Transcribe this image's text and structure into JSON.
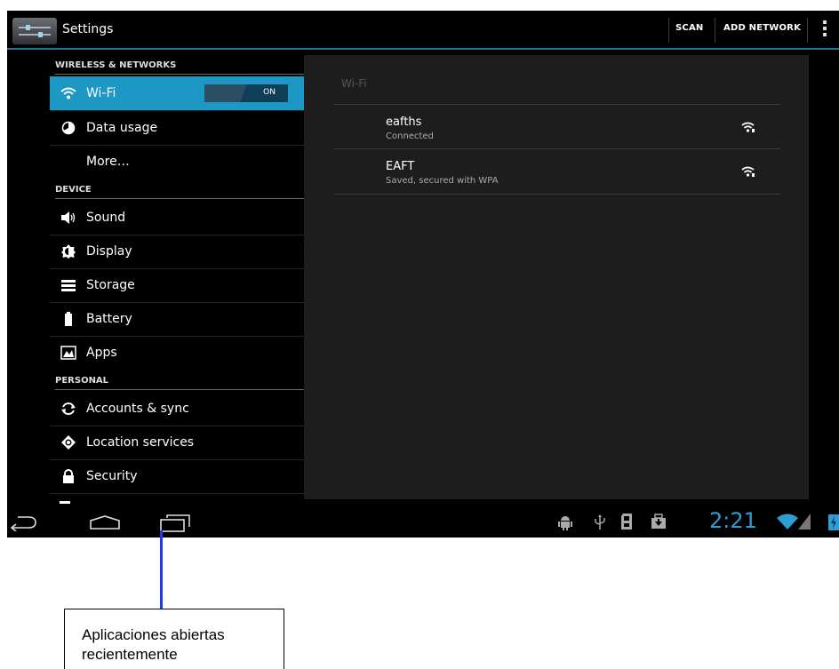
{
  "actionbar": {
    "title": "Settings",
    "scan": "SCAN",
    "add_network": "ADD NETWORK"
  },
  "sidebar": {
    "sections": [
      "WIRELESS & NETWORKS",
      "DEVICE",
      "PERSONAL"
    ],
    "items": [
      {
        "label": "Wi-Fi",
        "icon": "wifi-icon",
        "selected": true
      },
      {
        "label": "Data usage",
        "icon": "data-usage-icon"
      },
      {
        "label": "More…"
      },
      {
        "label": "Sound",
        "icon": "speaker-icon"
      },
      {
        "label": "Display",
        "icon": "brightness-icon"
      },
      {
        "label": "Storage",
        "icon": "storage-icon"
      },
      {
        "label": "Battery",
        "icon": "battery-icon"
      },
      {
        "label": "Apps",
        "icon": "apps-icon"
      },
      {
        "label": "Accounts & sync",
        "icon": "sync-icon"
      },
      {
        "label": "Location services",
        "icon": "location-icon"
      },
      {
        "label": "Security",
        "icon": "lock-icon"
      }
    ],
    "wifi_toggle": "ON"
  },
  "panel": {
    "title": "Wi-Fi",
    "networks": [
      {
        "name": "eafths",
        "status": "Connected"
      },
      {
        "name": "EAFT",
        "status": "Saved, secured with WPA"
      }
    ]
  },
  "statusbar": {
    "time": "2:21"
  },
  "annotation": {
    "line1": "Aplicaciones abiertas",
    "line2": "recientemente"
  },
  "colors": {
    "accent": "#1d97c4",
    "clock": "#2f9ed4",
    "callout_line": "#1a3cf0"
  }
}
